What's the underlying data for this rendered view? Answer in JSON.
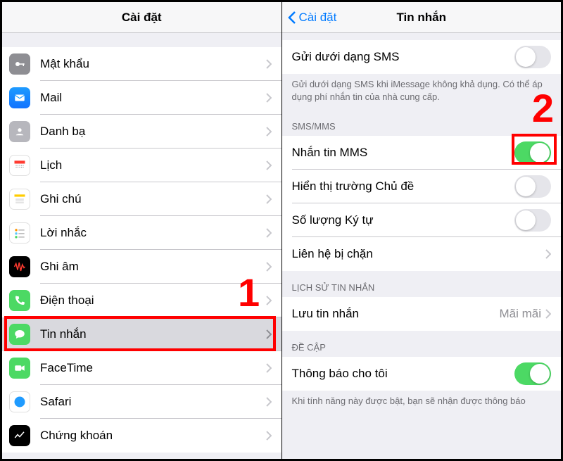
{
  "left": {
    "title": "Cài đặt",
    "items": [
      {
        "label": "Mật khẩu"
      },
      {
        "label": "Mail"
      },
      {
        "label": "Danh bạ"
      },
      {
        "label": "Lịch"
      },
      {
        "label": "Ghi chú"
      },
      {
        "label": "Lời nhắc"
      },
      {
        "label": "Ghi âm"
      },
      {
        "label": "Điện thoại"
      },
      {
        "label": "Tin nhắn"
      },
      {
        "label": "FaceTime"
      },
      {
        "label": "Safari"
      },
      {
        "label": "Chứng khoán"
      }
    ]
  },
  "right": {
    "back": "Cài đặt",
    "title": "Tin nhắn",
    "send_sms": {
      "label": "Gửi dưới dạng SMS",
      "footer": "Gửi dưới dạng SMS khi iMessage không khả dụng. Có thể áp dụng phí nhắn tin của nhà cung cấp."
    },
    "sections": {
      "smsmms": "SMS/MMS",
      "history": "LỊCH SỬ TIN NHẮN",
      "mentions": "ĐỀ CẬP"
    },
    "smsmms": [
      {
        "label": "Nhắn tin MMS",
        "on": true
      },
      {
        "label": "Hiển thị trường Chủ đề",
        "on": false
      },
      {
        "label": "Số lượng Ký tự",
        "on": false
      },
      {
        "label": "Liên hệ bị chặn"
      }
    ],
    "history": {
      "label": "Lưu tin nhắn",
      "value": "Mãi mãi"
    },
    "mentions": {
      "label": "Thông báo cho tôi",
      "on": true,
      "footer": "Khi tính năng này được bật, bạn sẽ nhận được thông báo"
    }
  },
  "annotations": [
    "1",
    "2"
  ]
}
